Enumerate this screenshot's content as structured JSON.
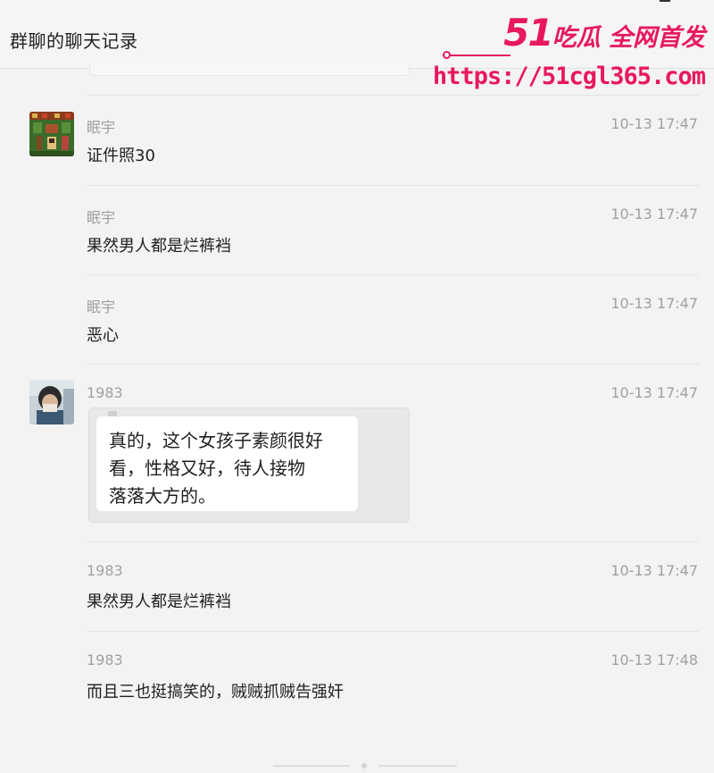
{
  "window": {
    "title": "群聊的聊天记录"
  },
  "watermark": {
    "brand_number": "51",
    "brand_text": "吃瓜 全网首发",
    "url": "https://51cgl365.com"
  },
  "messages": [
    {
      "sender": "眠宇",
      "time": "10-13 17:47",
      "text": "证件照30"
    },
    {
      "sender": "眠宇",
      "time": "10-13 17:47",
      "text": "果然男人都是烂裤裆"
    },
    {
      "sender": "眠宇",
      "time": "10-13 17:47",
      "text": "恶心"
    },
    {
      "sender": "1983",
      "time": "10-13 17:47",
      "quote_lines": [
        "真的，这个女孩子素颜很好",
        "看，性格又好，待人接物",
        "落落大方的。"
      ]
    },
    {
      "sender": "1983",
      "time": "10-13 17:47",
      "text": "果然男人都是烂裤裆"
    },
    {
      "sender": "1983",
      "time": "10-13 17:48",
      "text": "而且三也挺搞笑的，贼贼抓贼告强奸"
    }
  ]
}
